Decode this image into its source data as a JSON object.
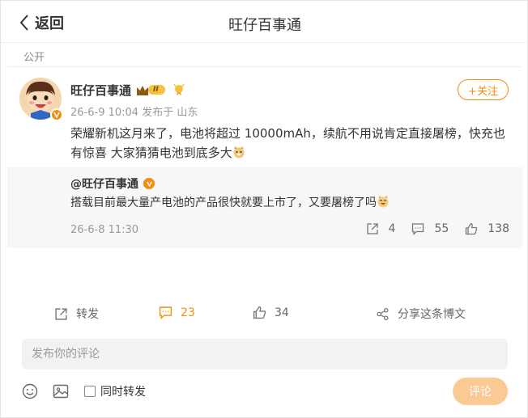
{
  "header": {
    "back_label": "返回",
    "title": "旺仔百事通"
  },
  "visibility": "公开",
  "post": {
    "author": "旺仔百事通",
    "vip_level": "II",
    "meta": "26-6-9 10:04 发布于 山东",
    "follow_label": "+关注",
    "text": "荣耀新机这月来了，电池将超过 10000mAh，续航不用说肯定直接屠榜，快充也有惊喜 大家猜猜电池到底多大"
  },
  "repost": {
    "author": "@旺仔百事通",
    "text": "搭载目前最大量产电池的产品很快就要上市了，又要屠榜了吗",
    "date": "26-6-8 11:30",
    "reposts": "4",
    "comments": "55",
    "likes": "138"
  },
  "actions": {
    "repost": "转发",
    "comments": "23",
    "likes": "34",
    "share": "分享这条博文"
  },
  "comment": {
    "placeholder": "发布你的评论",
    "also_repost": "同时转发",
    "submit": "评论"
  },
  "colors": {
    "accent": "#f18e0e",
    "submit_disabled": "#fbc994",
    "repost_bg": "#f7f7f7"
  }
}
